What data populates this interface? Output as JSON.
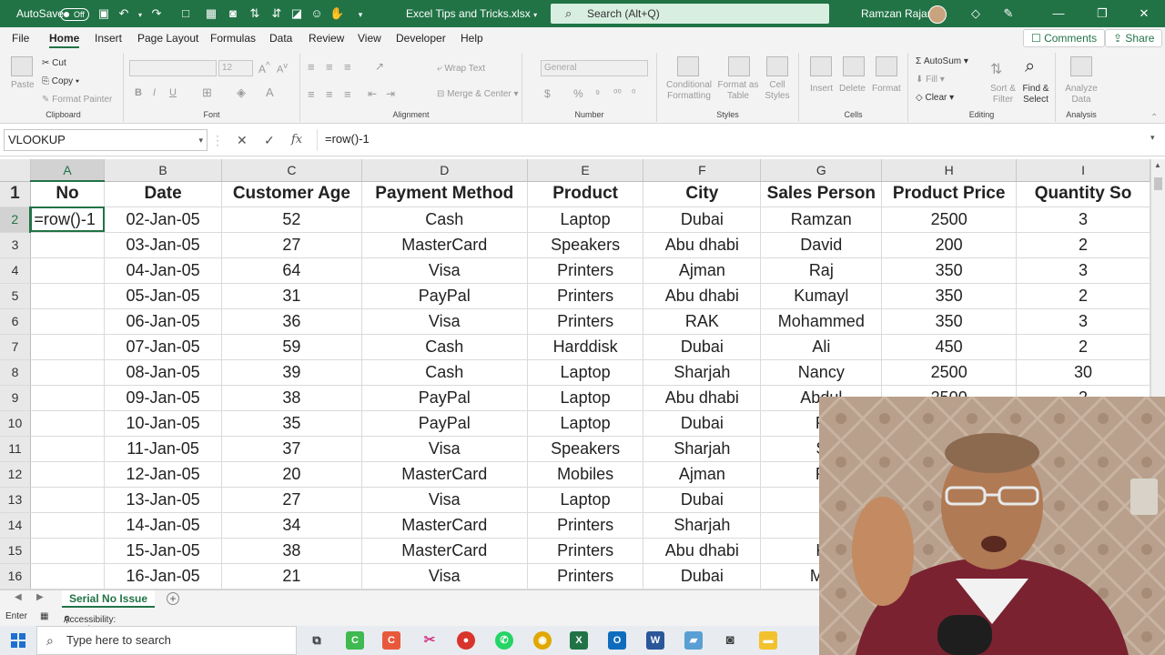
{
  "titlebar": {
    "autosave_label": "AutoSave",
    "autosave_state": "Off",
    "filename": "Excel Tips and Tricks.xlsx",
    "search_placeholder": "Search (Alt+Q)",
    "user_name": "Ramzan Rajani"
  },
  "menu": {
    "tabs": [
      "File",
      "Home",
      "Insert",
      "Page Layout",
      "Formulas",
      "Data",
      "Review",
      "View",
      "Developer",
      "Help"
    ],
    "active": "Home",
    "comments_label": "Comments",
    "share_label": "Share"
  },
  "ribbon": {
    "clipboard": {
      "paste": "Paste",
      "cut": "Cut",
      "copy": "Copy",
      "format_painter": "Format Painter",
      "label": "Clipboard"
    },
    "font": {
      "label": "Font",
      "size": "12",
      "bold": "B",
      "italic": "I",
      "underline": "U"
    },
    "alignment": {
      "wrap_text": "Wrap Text",
      "merge_center": "Merge & Center",
      "label": "Alignment"
    },
    "number": {
      "format": "General",
      "label": "Number"
    },
    "styles": {
      "conditional": "Conditional Formatting",
      "format_table": "Format as Table",
      "cell_styles": "Cell Styles",
      "label": "Styles"
    },
    "cells": {
      "insert": "Insert",
      "delete": "Delete",
      "format": "Format",
      "label": "Cells"
    },
    "editing": {
      "autosum": "AutoSum",
      "fill": "Fill",
      "clear": "Clear",
      "sort_filter": "Sort & Filter",
      "find_select": "Find & Select",
      "label": "Editing"
    },
    "analysis": {
      "analyze": "Analyze Data",
      "label": "Analysis"
    }
  },
  "formula_bar": {
    "name_box": "VLOOKUP",
    "formula": "=row()-1"
  },
  "sheet": {
    "columns": [
      "A",
      "B",
      "C",
      "D",
      "E",
      "F",
      "G",
      "H",
      "I"
    ],
    "header_row": [
      "No",
      "Date",
      "Customer Age",
      "Payment Method",
      "Product",
      "City",
      "Sales Person",
      "Product Price",
      "Quantity So"
    ],
    "rows": [
      [
        "=row()-1",
        "02-Jan-05",
        "52",
        "Cash",
        "Laptop",
        "Dubai",
        "Ramzan",
        "2500",
        "3"
      ],
      [
        "",
        "03-Jan-05",
        "27",
        "MasterCard",
        "Speakers",
        "Abu dhabi",
        "David",
        "200",
        "2"
      ],
      [
        "",
        "04-Jan-05",
        "64",
        "Visa",
        "Printers",
        "Ajman",
        "Raj",
        "350",
        "3"
      ],
      [
        "",
        "05-Jan-05",
        "31",
        "PayPal",
        "Printers",
        "Abu dhabi",
        "Kumayl",
        "350",
        "2"
      ],
      [
        "",
        "06-Jan-05",
        "36",
        "Visa",
        "Printers",
        "RAK",
        "Mohammed",
        "350",
        "3"
      ],
      [
        "",
        "07-Jan-05",
        "59",
        "Cash",
        "Harddisk",
        "Dubai",
        "Ali",
        "450",
        "2"
      ],
      [
        "",
        "08-Jan-05",
        "39",
        "Cash",
        "Laptop",
        "Sharjah",
        "Nancy",
        "2500",
        "30"
      ],
      [
        "",
        "09-Jan-05",
        "38",
        "PayPal",
        "Laptop",
        "Abu dhabi",
        "Abdul",
        "2500",
        "2"
      ],
      [
        "",
        "10-Jan-05",
        "35",
        "PayPal",
        "Laptop",
        "Dubai",
        "R",
        "",
        ""
      ],
      [
        "",
        "11-Jan-05",
        "37",
        "Visa",
        "Speakers",
        "Sharjah",
        "S",
        "",
        ""
      ],
      [
        "",
        "12-Jan-05",
        "20",
        "MasterCard",
        "Mobiles",
        "Ajman",
        "R",
        "",
        ""
      ],
      [
        "",
        "13-Jan-05",
        "27",
        "Visa",
        "Laptop",
        "Dubai",
        "",
        "",
        ""
      ],
      [
        "",
        "14-Jan-05",
        "34",
        "MasterCard",
        "Printers",
        "Sharjah",
        "",
        "",
        ""
      ],
      [
        "",
        "15-Jan-05",
        "38",
        "MasterCard",
        "Printers",
        "Abu dhabi",
        "K",
        "",
        ""
      ],
      [
        "",
        "16-Jan-05",
        "21",
        "Visa",
        "Printers",
        "Dubai",
        "Mo",
        "",
        ""
      ]
    ],
    "tab_name": "Serial No Issue"
  },
  "status": {
    "mode": "Enter",
    "accessibility": "Accessibility: Investigate"
  },
  "taskbar": {
    "search_placeholder": "Type here to search"
  }
}
